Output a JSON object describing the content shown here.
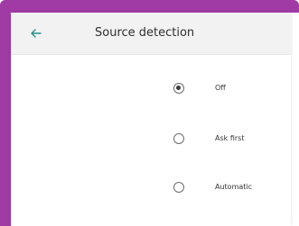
{
  "header": {
    "title": "Source detection",
    "back_icon": "arrow-left-icon"
  },
  "options": [
    {
      "label": "Off",
      "selected": true
    },
    {
      "label": "Ask first",
      "selected": false
    },
    {
      "label": "Automatic",
      "selected": false
    }
  ],
  "colors": {
    "accent": "#a03ba6",
    "header_bg": "#f2f2f2",
    "back_arrow": "#2a8f8c"
  }
}
